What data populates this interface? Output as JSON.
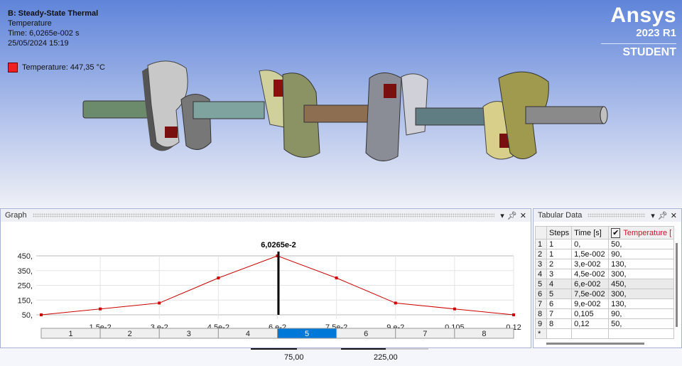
{
  "viewport": {
    "title": "B: Steady-State Thermal",
    "result": "Temperature",
    "time": "Time: 6,0265e-002 s",
    "date": "25/05/2024 15:19",
    "legend": "Temperature: 447,35 °C",
    "legend_color": "#f02020"
  },
  "logo": {
    "brand": "Ansys",
    "version": "2023 R1",
    "edition": "STUDENT"
  },
  "graph": {
    "title": "Graph",
    "cursor_label": "6,0265e-2",
    "steps": [
      "1",
      "2",
      "3",
      "4",
      "5",
      "6",
      "7",
      "8"
    ],
    "selected_step": 5
  },
  "chart_data": {
    "type": "line",
    "x": [
      0,
      0.015,
      0.03,
      0.045,
      0.06,
      0.075,
      0.09,
      0.105,
      0.12
    ],
    "y": [
      50,
      90,
      130,
      300,
      450,
      300,
      130,
      90,
      50
    ],
    "xlim": [
      0,
      0.12
    ],
    "ylim": [
      50,
      450
    ],
    "x_ticks": [
      "1,5e-2",
      "3,e-2",
      "4,5e-2",
      "6,e-2",
      "7,5e-2",
      "9,e-2",
      "0,105",
      "0,12"
    ],
    "y_ticks": [
      "450,",
      "350,",
      "250,",
      "150,",
      "50,"
    ],
    "cursor_x": 0.060265,
    "color": "#cc0000"
  },
  "tabular": {
    "title": "Tabular Data",
    "headers": [
      "Steps",
      "Time [s]",
      "Temperature ["
    ],
    "rows": [
      [
        "1",
        "1",
        "0,",
        "50,"
      ],
      [
        "2",
        "1",
        "1,5e-002",
        "90,"
      ],
      [
        "3",
        "2",
        "3,e-002",
        "130,"
      ],
      [
        "4",
        "3",
        "4,5e-002",
        "300,"
      ],
      [
        "5",
        "4",
        "6,e-002",
        "450,"
      ],
      [
        "6",
        "5",
        "7,5e-002",
        "300,"
      ],
      [
        "7",
        "6",
        "9,e-002",
        "130,"
      ],
      [
        "8",
        "7",
        "0,105",
        "90,"
      ],
      [
        "9",
        "8",
        "0,12",
        "50,"
      ],
      [
        "*",
        "",
        "",
        ""
      ]
    ]
  },
  "scale": {
    "a": "75,00",
    "b": "225,00"
  }
}
